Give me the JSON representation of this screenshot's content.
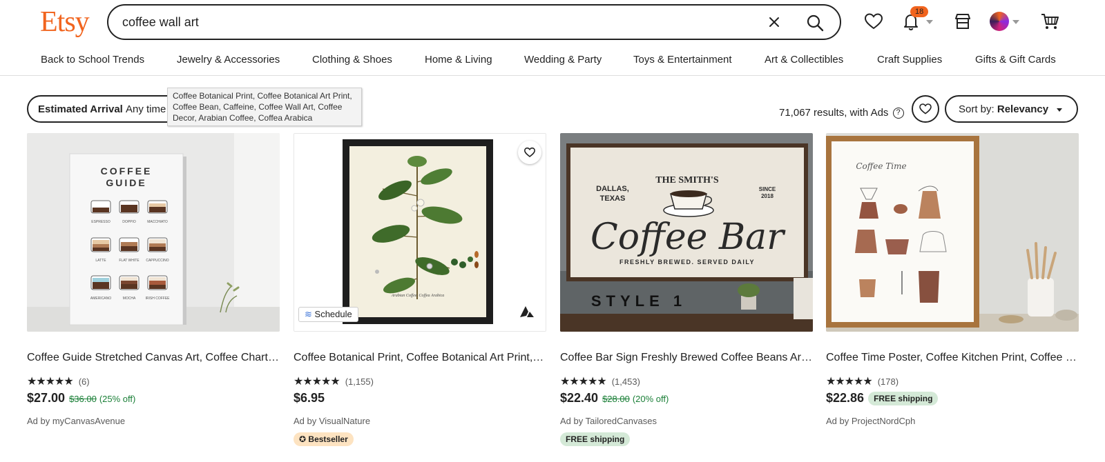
{
  "header": {
    "logo": "Etsy",
    "search_value": "coffee wall art",
    "notification_count": "18"
  },
  "nav": [
    "Back to School Trends",
    "Jewelry & Accessories",
    "Clothing & Shoes",
    "Home & Living",
    "Wedding & Party",
    "Toys & Entertainment",
    "Art & Collectibles",
    "Craft Supplies",
    "Gifts & Gift Cards"
  ],
  "filters": {
    "estimated_arrival_label": "Estimated Arrival",
    "estimated_arrival_value": "Any time",
    "tooltip": "Coffee Botanical Print, Coffee Botanical Art Print, Coffee Bean, Caffeine, Coffee Wall Art, Coffee Decor, Arabian Coffee, Coffea Arabica",
    "results": "71,067 results, with Ads",
    "help": "?",
    "sort_label": "Sort by:",
    "sort_value": "Relevancy"
  },
  "listings": [
    {
      "title": "Coffee Guide Stretched Canvas Art, Coffee Chart Wall Art, Coffee Types Print",
      "stars": "★★★★★",
      "reviews": "(6)",
      "price": "$27.00",
      "original_price": "$36.00",
      "discount": "(25% off)",
      "ad_by": "Ad by myCanvasAvenue",
      "image": {
        "heading1": "COFFEE",
        "heading2": "GUIDE",
        "cups": [
          "ESPRESSO",
          "DOPPIO",
          "MACCHIATO",
          "LATTE",
          "FLAT WHITE",
          "CAPPUCCINO",
          "AMERICANO",
          "MOCHA",
          "IRISH COFFEE"
        ]
      }
    },
    {
      "title": "Coffee Botanical Print, Coffee Botanical Art Print, Coffee Bean, Caffeine",
      "stars": "★★★★★",
      "reviews": "(1,155)",
      "price": "$6.95",
      "ad_by": "Ad by VisualNature",
      "tag": "Bestseller",
      "schedule": "Schedule",
      "image": {
        "caption": "Arabian Coffee. Coffea Arabica"
      }
    },
    {
      "title": "Coffee Bar Sign Freshly Brewed Coffee Beans Art Canvas Print",
      "stars": "★★★★★",
      "reviews": "(1,453)",
      "price": "$22.40",
      "original_price": "$28.00",
      "discount": "(20% off)",
      "ad_by": "Ad by TailoredCanvases",
      "tag": "FREE shipping",
      "image": {
        "smiths": "THE SMITH'S",
        "city": "DALLAS,",
        "state": "TEXAS",
        "since": "SINCE",
        "year": "2018",
        "main": "Coffee Bar",
        "sub": "FRESHLY BREWED. SERVED DAILY",
        "style": "STYLE 1"
      }
    },
    {
      "title": "Coffee Time Poster, Coffee Kitchen Print, Coffee Lover Gift",
      "stars": "★★★★★",
      "reviews": "(178)",
      "price": "$22.86",
      "free_shipping": "FREE shipping",
      "ad_by": "Ad by ProjectNordCph",
      "image": {
        "script": "Coffee Time"
      }
    }
  ],
  "colors": {
    "brand": "#f1641e",
    "discount": "#1a7f37",
    "free_shipping_bg": "#d4e9d7",
    "bestseller_bg": "#fde3c1"
  }
}
